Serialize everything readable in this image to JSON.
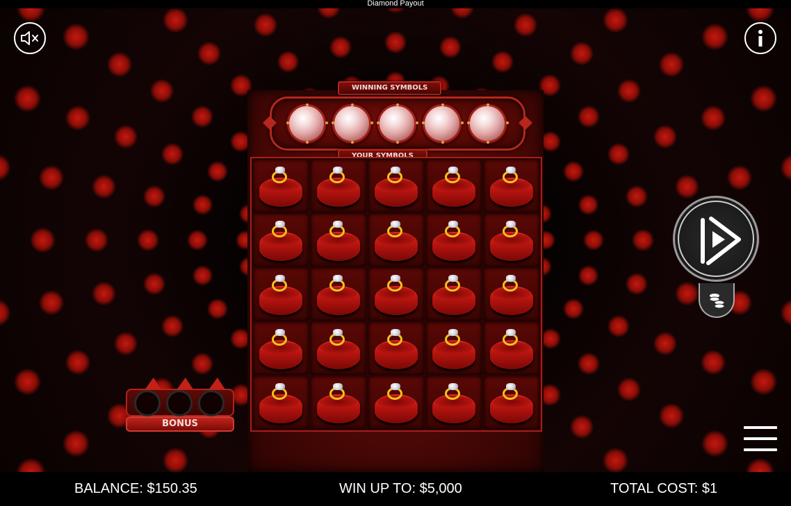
{
  "window": {
    "title": "Diamond Payout"
  },
  "banners": {
    "winning_symbols": "WINNING SYMBOLS",
    "your_symbols": "YOUR SYMBOLS"
  },
  "winning_symbols": [
    "diamond",
    "diamond",
    "diamond",
    "diamond",
    "diamond"
  ],
  "your_symbols": {
    "rows": 5,
    "cols": 5,
    "symbol": "ring-box"
  },
  "bonus": {
    "label": "BONUS",
    "collected": 0,
    "slots": 3
  },
  "controls": {
    "sound_icon": "speaker-muted-icon",
    "info_icon": "info-icon",
    "play_icon": "play-icon",
    "coins_icon": "coins-icon",
    "menu_icon": "hamburger-menu-icon"
  },
  "footer": {
    "balance": "BALANCE: $150.35",
    "win_up_to": "WIN UP TO: $5,000",
    "total_cost": "TOTAL COST: $1"
  },
  "colors": {
    "accent": "#b7261d",
    "ring_gold": "#f4c31c",
    "background": "#000000"
  }
}
